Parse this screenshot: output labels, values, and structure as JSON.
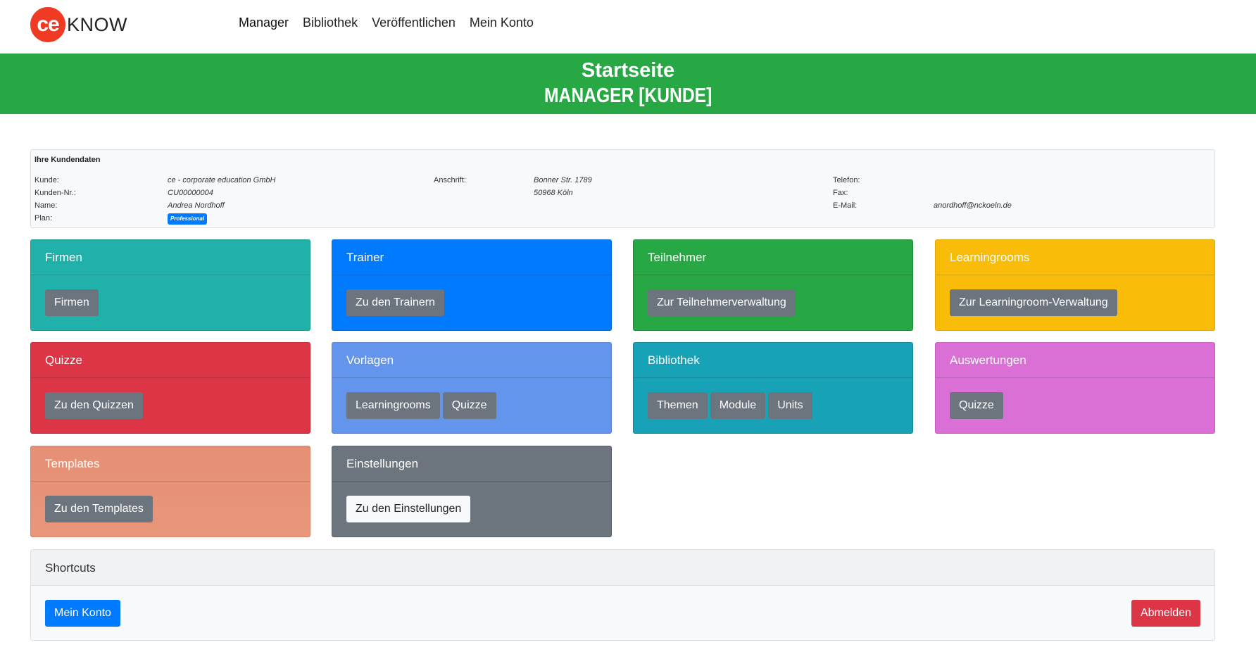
{
  "brand": {
    "logo_mark": "ce",
    "logo_text": "KNOW",
    "accent": "#ef3b24"
  },
  "nav": {
    "items": [
      "Manager",
      "Bibliothek",
      "Veröffentlichen",
      "Mein Konto"
    ]
  },
  "banner": {
    "title": "Startseite",
    "subtitle": "MANAGER [KUNDE]",
    "color": "#28a745"
  },
  "kunden": {
    "title": "Ihre Kundendaten",
    "kunde_label": "Kunde:",
    "kunde": "ce - corporate education GmbH",
    "nr_label": "Kunden-Nr.:",
    "nr": "CU00000004",
    "name_label": "Name:",
    "name": "Andrea Nordhoff",
    "plan_label": "Plan:",
    "plan": "Professional",
    "anschrift_label": "Anschrift:",
    "street": "Bonner Str. 1789",
    "city": "50968 Köln",
    "telefon_label": "Telefon:",
    "fax_label": "Fax:",
    "email_label": "E-Mail:",
    "email": "anordhoff@nckoeln.de"
  },
  "cards": {
    "firmen": {
      "title": "Firmen",
      "btn1": "Firmen",
      "color": "#20b2aa"
    },
    "trainer": {
      "title": "Trainer",
      "btn1": "Zu den Trainern",
      "color": "#007bff"
    },
    "teilnehmer": {
      "title": "Teilnehmer",
      "btn1": "Zur Teilnehmerverwaltung",
      "color": "#28a745"
    },
    "learningrooms": {
      "title": "Learningrooms",
      "btn1": "Zur Learningroom-Verwaltung",
      "color": "#f9bc09"
    },
    "quizze": {
      "title": "Quizze",
      "btn1": "Zu den Quizzen",
      "color": "#dc3545"
    },
    "vorlagen": {
      "title": "Vorlagen",
      "btn1": "Learningrooms",
      "btn2": "Quizze",
      "color": "#6495ed"
    },
    "bibliothek": {
      "title": "Bibliothek",
      "btn1": "Themen",
      "btn2": "Module",
      "btn3": "Units",
      "color": "#17a2b8"
    },
    "auswertungen": {
      "title": "Auswertungen",
      "btn1": "Quizze",
      "color": "#da70d6"
    },
    "templates": {
      "title": "Templates",
      "btn1": "Zu den Templates",
      "color": "#e9967a"
    },
    "einstellungen": {
      "title": "Einstellungen",
      "btn1": "Zu den Einstellungen",
      "color": "#6c757d"
    }
  },
  "shortcuts": {
    "title": "Shortcuts",
    "konto": "Mein Konto",
    "abmelden": "Abmelden"
  }
}
